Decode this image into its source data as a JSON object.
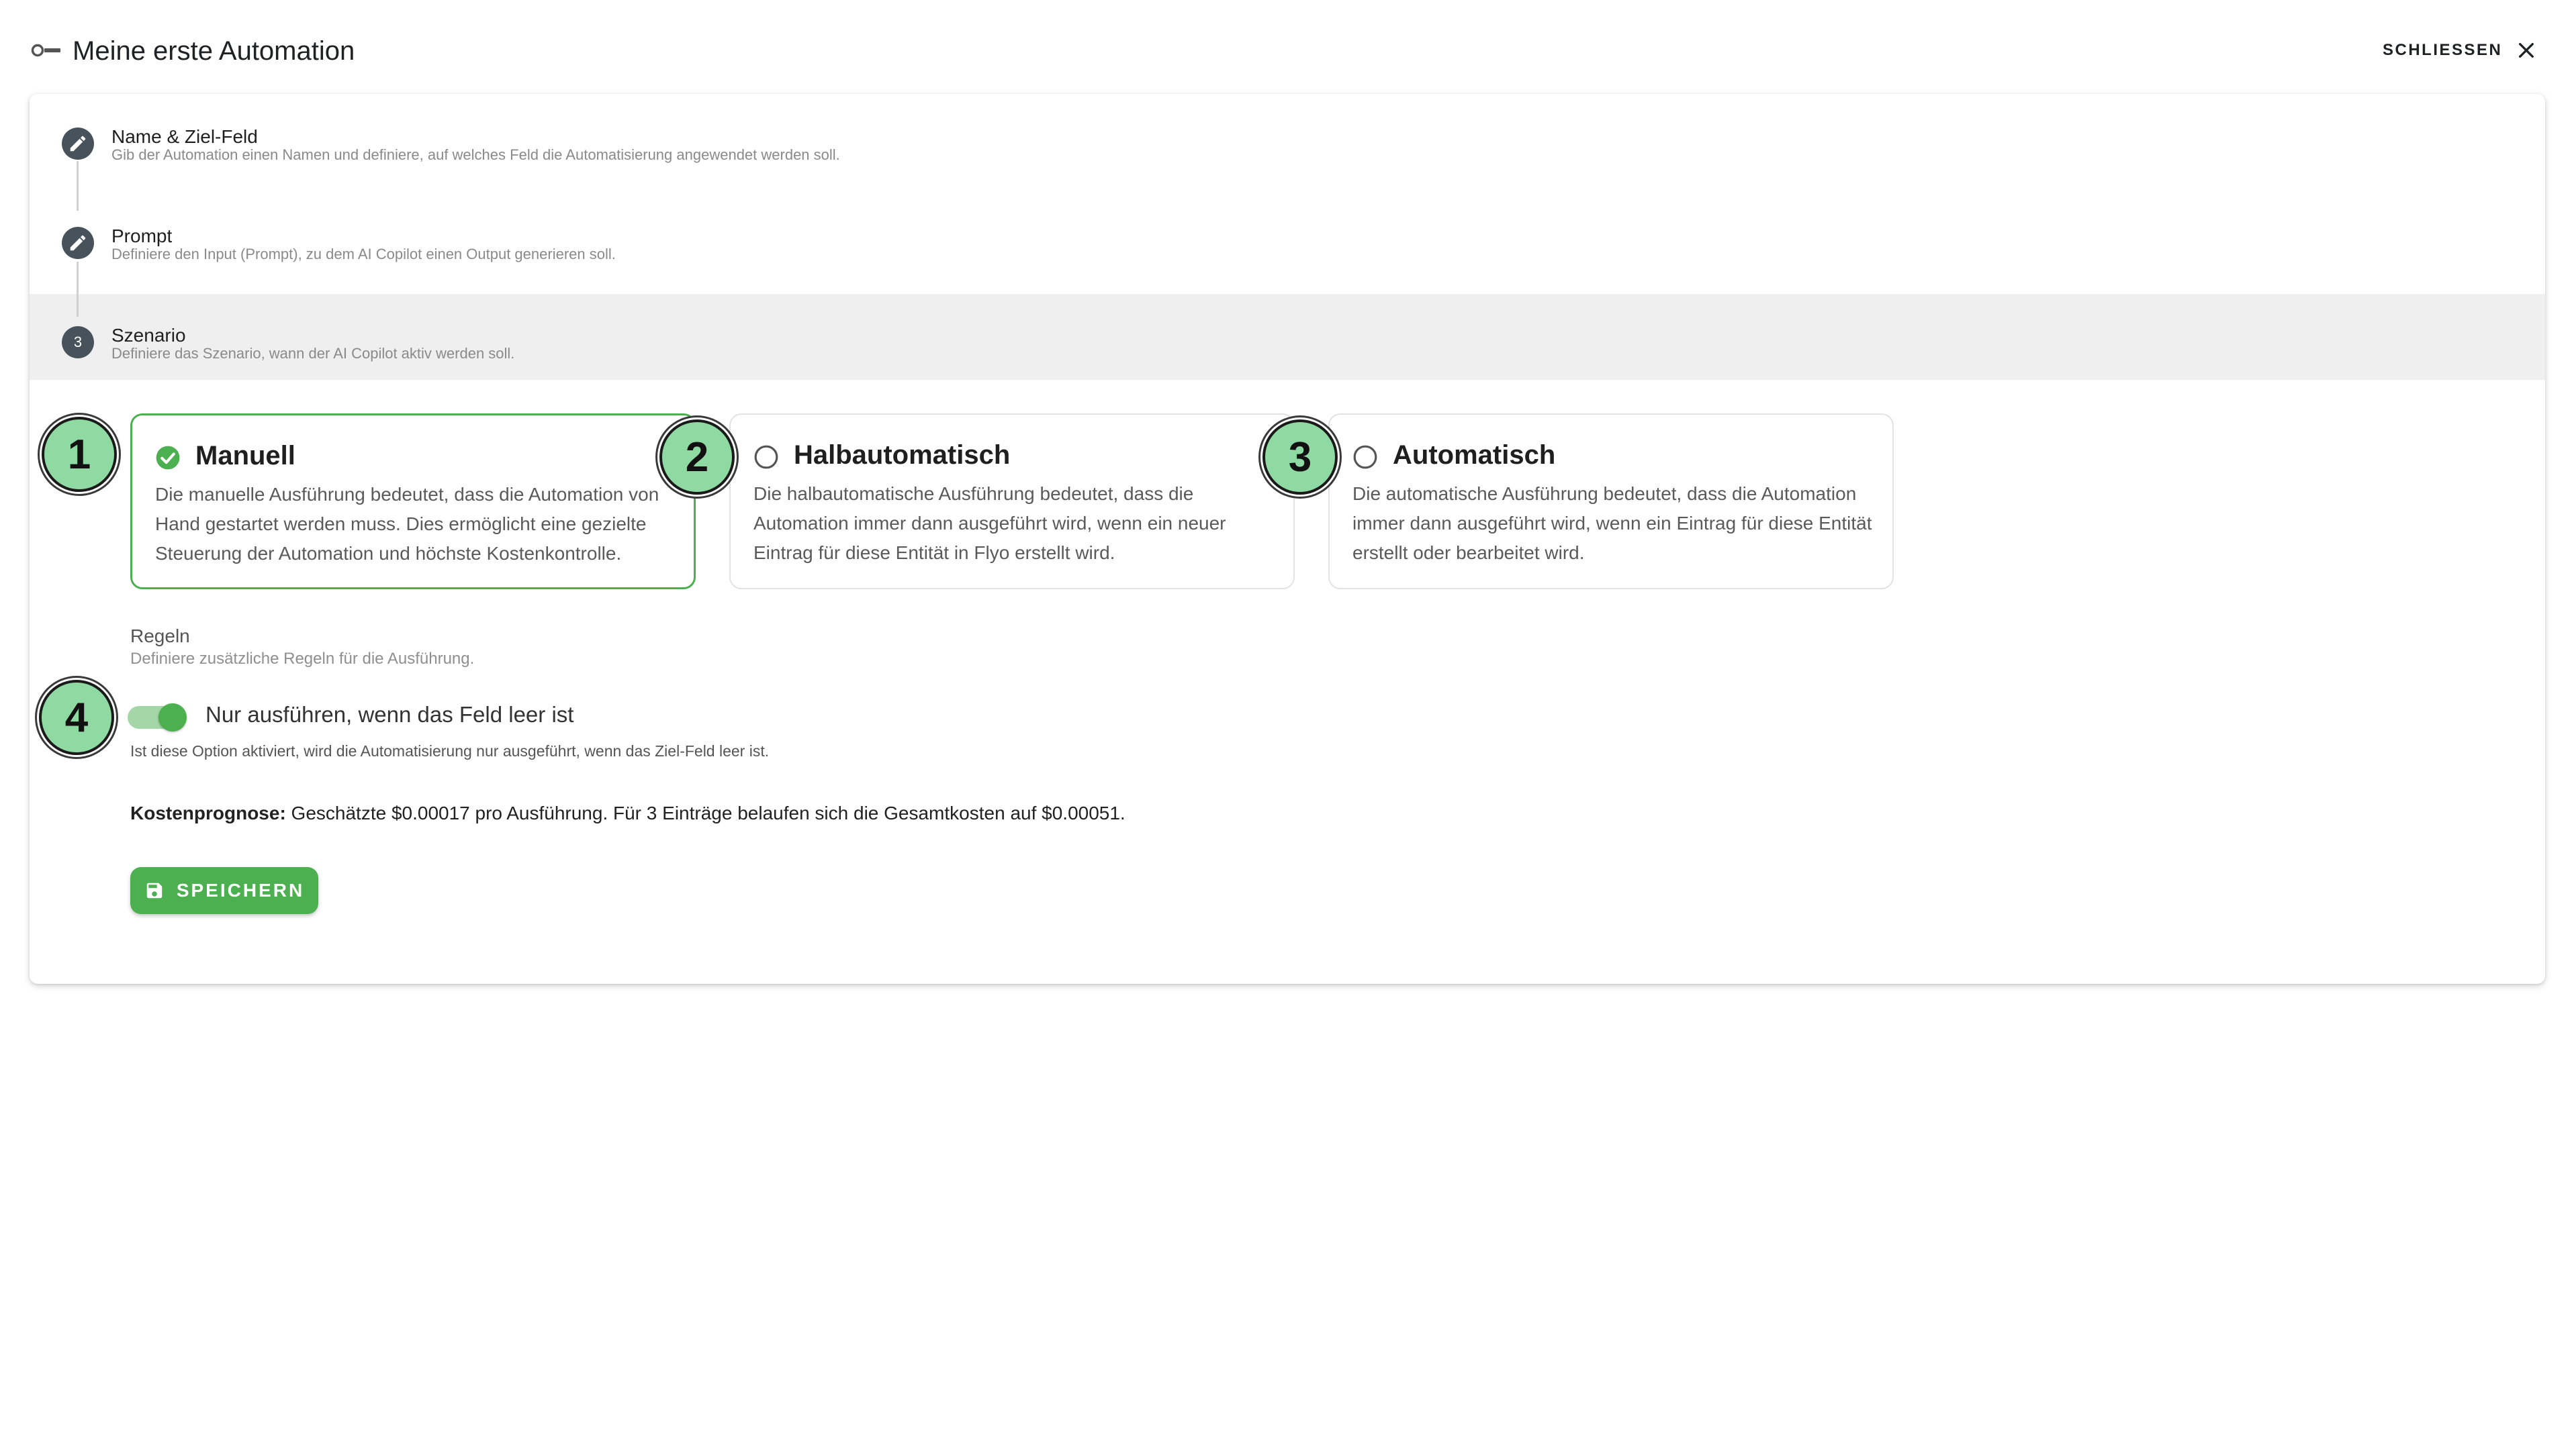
{
  "header": {
    "title": "Meine erste Automation",
    "title_icon": "key-icon",
    "close_label": "SCHLIESSEN",
    "close_icon": "close-icon"
  },
  "steps": [
    {
      "title": "Name & Ziel-Feld",
      "subtitle": "Gib der Automation einen Namen und definiere, auf welches Feld die Automatisierung angewendet werden soll.",
      "icon": "pencil-icon",
      "state": "completed"
    },
    {
      "title": "Prompt",
      "subtitle": "Definiere den Input (Prompt), zu dem AI Copilot einen Output generieren soll.",
      "icon": "pencil-icon",
      "state": "completed"
    },
    {
      "number": "3",
      "title": "Szenario",
      "subtitle": "Definiere das Szenario, wann der AI Copilot aktiv werden soll.",
      "state": "active"
    }
  ],
  "scenario_options": [
    {
      "marker": "1",
      "title": "Manuell",
      "description": "Die manuelle Ausführung bedeutet, dass die Automation von Hand gestartet werden muss. Dies ermöglicht eine gezielte Steuerung der Automation und höchste Kostenkontrolle.",
      "selected": true
    },
    {
      "marker": "2",
      "title": "Halbautomatisch",
      "description": "Die halbautomatische Ausführung bedeutet, dass die Automation immer dann ausgeführt wird, wenn ein neuer Eintrag für diese Entität in Flyo erstellt wird.",
      "selected": false
    },
    {
      "marker": "3",
      "title": "Automatisch",
      "description": "Die automatische Ausführung bedeutet, dass die Automation immer dann ausgeführt wird, wenn ein Eintrag für diese Entität erstellt oder bearbeitet wird.",
      "selected": false
    }
  ],
  "rules": {
    "title": "Regeln",
    "subtitle": "Definiere zusätzliche Regeln für die Ausführung.",
    "marker": "4",
    "toggle_label": "Nur ausführen, wenn das Feld leer ist",
    "toggle_on": true,
    "toggle_help": "Ist diese Option aktiviert, wird die Automatisierung nur ausgeführt, wenn das Ziel-Feld leer ist."
  },
  "cost": {
    "label": "Kostenprognose:",
    "text": " Geschätzte $0.00017 pro Ausführung. Für 3 Einträge belaufen sich die Gesamtkosten auf $0.00051."
  },
  "save_button": {
    "label": "SPEICHERN",
    "icon": "save-icon"
  },
  "colors": {
    "accent": "#4caf50",
    "accent_light": "#a5d6a7",
    "marker_fill": "#8fd9a3",
    "step_badge": "#47525b",
    "active_step_bg": "#efefef"
  }
}
